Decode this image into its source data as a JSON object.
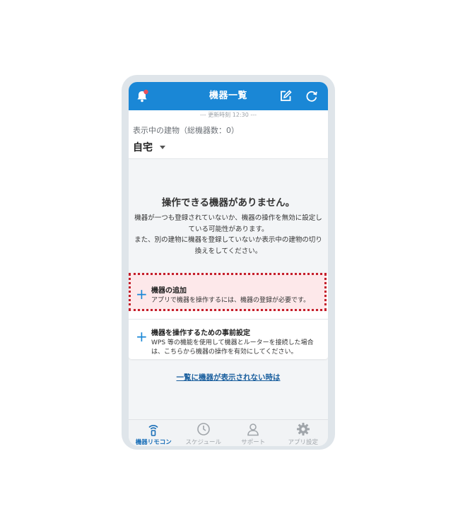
{
  "header": {
    "title": "機器一覧"
  },
  "updated": "--- 更新時刻 12:30 ---",
  "building": {
    "label": "表示中の建物（総機器数：0）",
    "name": "自宅"
  },
  "empty": {
    "title": "操作できる機器がありません。",
    "desc_lines": [
      "機器が一つも登録されていないか、機器の操作を無効に設定し",
      "ている可能性があります。",
      "また、別の建物に機器を登録していないか表示中の建物の切り",
      "換えをしてください。"
    ]
  },
  "actions": [
    {
      "title": "機器の追加",
      "desc": "アプリで機器を操作するには、機器の登録が必要です。"
    },
    {
      "title": "機器を操作するための事前設定",
      "desc": "WPS 等の機能を使用して機器とルーターを接続した場合は、こちらから機器の操作を有効にしてください。"
    }
  ],
  "link": "一覧に機器が表示されない時は",
  "tabs": [
    {
      "label": "機器リモコン",
      "icon": "remote-icon",
      "active": true
    },
    {
      "label": "スケジュール",
      "icon": "clock-icon",
      "active": false
    },
    {
      "label": "サポート",
      "icon": "person-icon",
      "active": false
    },
    {
      "label": "アプリ設定",
      "icon": "gear-icon",
      "active": false
    }
  ],
  "colors": {
    "accent": "#1a87d6",
    "highlight_border": "#c41e2a",
    "highlight_fill": "#fde8ea",
    "notification_dot": "#e8505b"
  }
}
